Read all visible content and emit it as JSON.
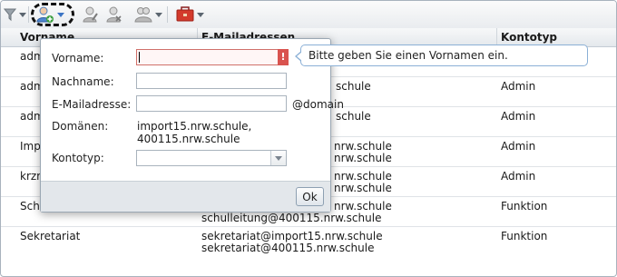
{
  "toolbar": {
    "buttons": [
      {
        "icon": "filter-icon"
      },
      {
        "icon": "add-user-icon"
      },
      {
        "icon": "edit-user-icon"
      },
      {
        "icon": "remove-user-icon"
      },
      {
        "icon": "user-group-icon"
      },
      {
        "icon": "toolbox-icon"
      }
    ]
  },
  "grid": {
    "columns": [
      "Vorname",
      "E-Mailadressen",
      "Kontotyp"
    ],
    "rows": [
      {
        "name": "adm",
        "emails": [
          "",
          ""
        ],
        "type": ""
      },
      {
        "name": "adm",
        "emails": [
          "",
          "schule"
        ],
        "type": "Admin"
      },
      {
        "name": "adm",
        "emails": [
          "",
          "schule"
        ],
        "type": "Admin"
      },
      {
        "name": "Imp",
        "emails": [
          "nrw.schule",
          "nrw.schule"
        ],
        "type": "Admin"
      },
      {
        "name": "krzr",
        "emails": [
          "nrw.schule",
          "nrw.schule"
        ],
        "type": "Admin"
      },
      {
        "name": "Sch",
        "emails": [
          "nrw.schule",
          "schulleitung@400115.nrw.schule"
        ],
        "type": "Funktion"
      },
      {
        "name": "Sekretariat",
        "emails": [
          "sekretariat@import15.nrw.schule",
          "sekretariat@400115.nrw.schule"
        ],
        "type": "Funktion"
      }
    ]
  },
  "dialog": {
    "firstname_label": "Vorname:",
    "firstname_value": "",
    "error_mark": "!",
    "lastname_label": "Nachname:",
    "lastname_value": "",
    "email_label": "E-Mailadresse:",
    "email_value": "",
    "email_domain": "@domain",
    "domains_label": "Domänen:",
    "domains_line1": "import15.nrw.schule,",
    "domains_line2": "400115.nrw.schule",
    "accounttype_label": "Kontotyp:",
    "accounttype_value": "",
    "ok_label": "Ok"
  },
  "tooltip": {
    "text": "Bitte geben Sie einen Vornamen ein."
  },
  "colors": {
    "error": "#d9534f",
    "accent": "#3b74c4"
  }
}
